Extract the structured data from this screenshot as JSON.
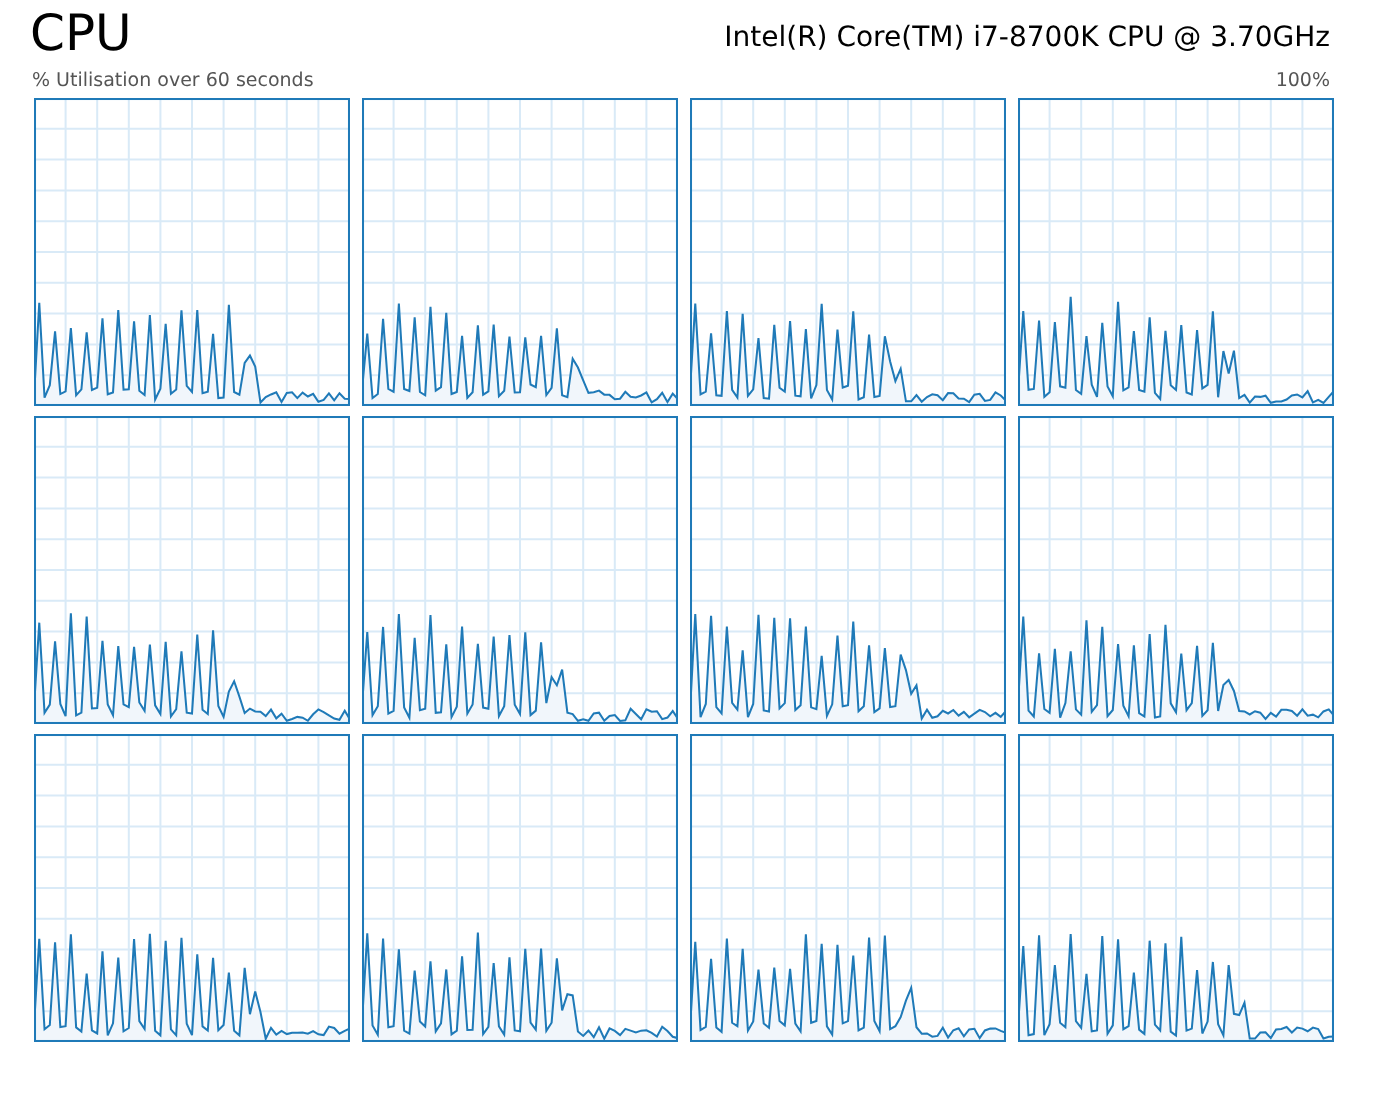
{
  "title": "CPU",
  "processor": "Intel(R) Core(TM) i7-8700K CPU @ 3.70GHz",
  "axis_label": "% Utilisation over 60 seconds",
  "max_label": "100%",
  "graphs": [
    {
      "kind": "sparkline"
    },
    {
      "kind": "sparkline"
    },
    {
      "kind": "sparkline"
    },
    {
      "kind": "sparkline"
    },
    {
      "kind": "sparkline"
    },
    {
      "kind": "sparkline"
    },
    {
      "kind": "sparkline"
    },
    {
      "kind": "sparkline"
    },
    {
      "kind": "sparkline"
    },
    {
      "kind": "sparkline"
    },
    {
      "kind": "sparkline"
    },
    {
      "kind": "sparkline"
    }
  ]
}
